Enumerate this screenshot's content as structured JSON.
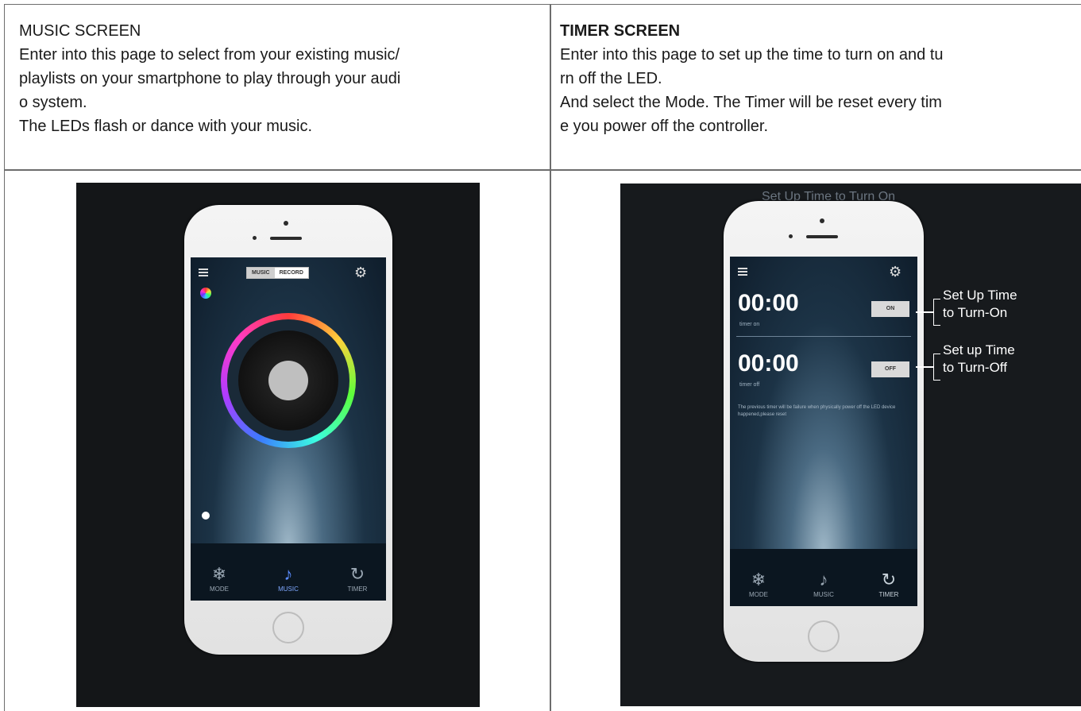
{
  "music_cell": {
    "heading": "MUSIC SCREEN",
    "line1": "Enter into this page to select from your existing music/",
    "line2": "playlists on your smartphone to play through your audi",
    "line3": "o system.",
    "line4": "The LEDs flash or dance with your music."
  },
  "timer_cell": {
    "heading": "TIMER SCREEN",
    "line1": "Enter into this page to set up the time to turn on and tu",
    "line2": "rn off the LED.",
    "line3": "And select the Mode. The Timer will be reset every tim",
    "line4": "e you power off the controller."
  },
  "music_phone": {
    "seg_music": "MUSIC",
    "seg_record": "RECORD",
    "nav": [
      {
        "label": "MODE",
        "icon": "snowflake-icon"
      },
      {
        "label": "MUSIC",
        "icon": "music-note-icon"
      },
      {
        "label": "TIMER",
        "icon": "timer-icon"
      }
    ]
  },
  "timer_phone": {
    "banner": "Set Up Time to Turn On",
    "time_on": "00:00",
    "time_on_label": "timer on",
    "btn_on": "ON",
    "time_off": "00:00",
    "time_off_label": "timer off",
    "btn_off": "OFF",
    "note": "The previous timer will be failure when physically power off the LED device happened,please reset",
    "callout_on_1": "Set Up Time",
    "callout_on_2": "to Turn-On",
    "callout_off_1": "Set up Time",
    "callout_off_2": "to Turn-Off",
    "nav": [
      {
        "label": "MODE",
        "icon": "snowflake-icon"
      },
      {
        "label": "MUSIC",
        "icon": "music-note-icon"
      },
      {
        "label": "TIMER",
        "icon": "timer-icon"
      }
    ]
  }
}
